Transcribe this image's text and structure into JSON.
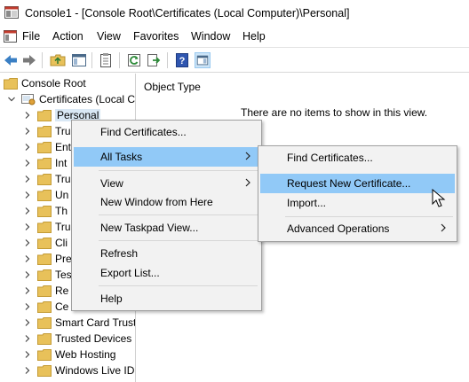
{
  "window": {
    "title": "Console1 - [Console Root\\Certificates (Local Computer)\\Personal]"
  },
  "menubar": {
    "items": [
      "File",
      "Action",
      "View",
      "Favorites",
      "Window",
      "Help"
    ]
  },
  "tree": {
    "root": "Console Root",
    "certificates": "Certificates (Local C",
    "children": [
      "Personal",
      "Tru",
      "Ent",
      "Int",
      "Tru",
      "Un",
      "Th",
      "Tru",
      "Cli",
      "Pre",
      "Tes",
      "Re",
      "Ce",
      "Smart Card Trust",
      "Trusted Devices",
      "Web Hosting",
      "Windows Live ID"
    ]
  },
  "details": {
    "column_header": "Object Type",
    "empty_message": "There are no items to show in this view."
  },
  "context_menu": {
    "items": [
      "Find Certificates...",
      "All Tasks",
      "View",
      "New Window from Here",
      "New Taskpad View...",
      "Refresh",
      "Export List...",
      "Help"
    ]
  },
  "submenu": {
    "items": [
      "Find Certificates...",
      "Request New Certificate...",
      "Import...",
      "Advanced Operations"
    ]
  },
  "colors": {
    "highlight": "#91c9f7",
    "folder": "#e8c15a",
    "menu_bg": "#f2f2f2"
  }
}
